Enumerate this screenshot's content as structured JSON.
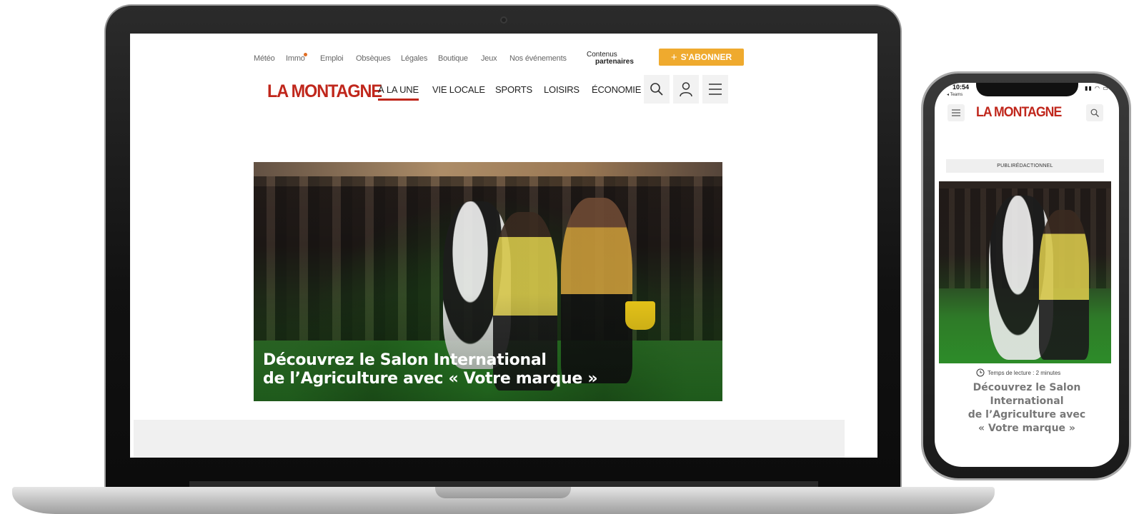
{
  "laptop": {
    "util_nav": [
      "Météo",
      "Immo",
      "Emploi",
      "Obsèques",
      "Légales",
      "Boutique",
      "Jeux",
      "Nos événements"
    ],
    "contenus_line1": "Contenus",
    "contenus_line2": "partenaires",
    "subscribe_label": "S'ABONNER",
    "logo": "LA MONTAGNE",
    "main_nav": [
      "À LA UNE",
      "VIE LOCALE",
      "SPORTS",
      "LOISIRS",
      "ÉCONOMIE"
    ],
    "active_nav": "À LA UNE",
    "hero_title_line1": "Découvrez le Salon International",
    "hero_title_line2": "de l’Agriculture avec « Votre marque »"
  },
  "phone": {
    "status_time": "10:54",
    "status_back": "◂ Teams",
    "logo": "LA MONTAGNE",
    "label": "PUBLIRÉDACTIONNEL",
    "reading_time": "Temps de lecture : 2 minutes",
    "title_line1": "Découvrez le Salon",
    "title_line2": "International",
    "title_line3": "de l’Agriculture avec",
    "title_line4": "« Votre marque »"
  },
  "colors": {
    "brand_red": "#c0271c",
    "subscribe_orange": "#efaa2e",
    "immo_dot": "#e06d24"
  },
  "icons": [
    "search-icon",
    "user-icon",
    "menu-icon",
    "clock-icon",
    "plus-icon"
  ]
}
